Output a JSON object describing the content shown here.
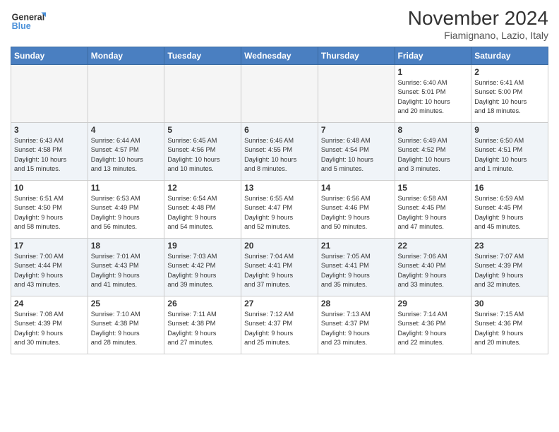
{
  "logo": {
    "line1": "General",
    "line2": "Blue"
  },
  "title": "November 2024",
  "location": "Fiamignano, Lazio, Italy",
  "days_of_week": [
    "Sunday",
    "Monday",
    "Tuesday",
    "Wednesday",
    "Thursday",
    "Friday",
    "Saturday"
  ],
  "weeks": [
    [
      {
        "num": "",
        "info": "",
        "empty": true
      },
      {
        "num": "",
        "info": "",
        "empty": true
      },
      {
        "num": "",
        "info": "",
        "empty": true
      },
      {
        "num": "",
        "info": "",
        "empty": true
      },
      {
        "num": "",
        "info": "",
        "empty": true
      },
      {
        "num": "1",
        "info": "Sunrise: 6:40 AM\nSunset: 5:01 PM\nDaylight: 10 hours\nand 20 minutes.",
        "empty": false
      },
      {
        "num": "2",
        "info": "Sunrise: 6:41 AM\nSunset: 5:00 PM\nDaylight: 10 hours\nand 18 minutes.",
        "empty": false
      }
    ],
    [
      {
        "num": "3",
        "info": "Sunrise: 6:43 AM\nSunset: 4:58 PM\nDaylight: 10 hours\nand 15 minutes.",
        "empty": false
      },
      {
        "num": "4",
        "info": "Sunrise: 6:44 AM\nSunset: 4:57 PM\nDaylight: 10 hours\nand 13 minutes.",
        "empty": false
      },
      {
        "num": "5",
        "info": "Sunrise: 6:45 AM\nSunset: 4:56 PM\nDaylight: 10 hours\nand 10 minutes.",
        "empty": false
      },
      {
        "num": "6",
        "info": "Sunrise: 6:46 AM\nSunset: 4:55 PM\nDaylight: 10 hours\nand 8 minutes.",
        "empty": false
      },
      {
        "num": "7",
        "info": "Sunrise: 6:48 AM\nSunset: 4:54 PM\nDaylight: 10 hours\nand 5 minutes.",
        "empty": false
      },
      {
        "num": "8",
        "info": "Sunrise: 6:49 AM\nSunset: 4:52 PM\nDaylight: 10 hours\nand 3 minutes.",
        "empty": false
      },
      {
        "num": "9",
        "info": "Sunrise: 6:50 AM\nSunset: 4:51 PM\nDaylight: 10 hours\nand 1 minute.",
        "empty": false
      }
    ],
    [
      {
        "num": "10",
        "info": "Sunrise: 6:51 AM\nSunset: 4:50 PM\nDaylight: 9 hours\nand 58 minutes.",
        "empty": false
      },
      {
        "num": "11",
        "info": "Sunrise: 6:53 AM\nSunset: 4:49 PM\nDaylight: 9 hours\nand 56 minutes.",
        "empty": false
      },
      {
        "num": "12",
        "info": "Sunrise: 6:54 AM\nSunset: 4:48 PM\nDaylight: 9 hours\nand 54 minutes.",
        "empty": false
      },
      {
        "num": "13",
        "info": "Sunrise: 6:55 AM\nSunset: 4:47 PM\nDaylight: 9 hours\nand 52 minutes.",
        "empty": false
      },
      {
        "num": "14",
        "info": "Sunrise: 6:56 AM\nSunset: 4:46 PM\nDaylight: 9 hours\nand 50 minutes.",
        "empty": false
      },
      {
        "num": "15",
        "info": "Sunrise: 6:58 AM\nSunset: 4:45 PM\nDaylight: 9 hours\nand 47 minutes.",
        "empty": false
      },
      {
        "num": "16",
        "info": "Sunrise: 6:59 AM\nSunset: 4:45 PM\nDaylight: 9 hours\nand 45 minutes.",
        "empty": false
      }
    ],
    [
      {
        "num": "17",
        "info": "Sunrise: 7:00 AM\nSunset: 4:44 PM\nDaylight: 9 hours\nand 43 minutes.",
        "empty": false
      },
      {
        "num": "18",
        "info": "Sunrise: 7:01 AM\nSunset: 4:43 PM\nDaylight: 9 hours\nand 41 minutes.",
        "empty": false
      },
      {
        "num": "19",
        "info": "Sunrise: 7:03 AM\nSunset: 4:42 PM\nDaylight: 9 hours\nand 39 minutes.",
        "empty": false
      },
      {
        "num": "20",
        "info": "Sunrise: 7:04 AM\nSunset: 4:41 PM\nDaylight: 9 hours\nand 37 minutes.",
        "empty": false
      },
      {
        "num": "21",
        "info": "Sunrise: 7:05 AM\nSunset: 4:41 PM\nDaylight: 9 hours\nand 35 minutes.",
        "empty": false
      },
      {
        "num": "22",
        "info": "Sunrise: 7:06 AM\nSunset: 4:40 PM\nDaylight: 9 hours\nand 33 minutes.",
        "empty": false
      },
      {
        "num": "23",
        "info": "Sunrise: 7:07 AM\nSunset: 4:39 PM\nDaylight: 9 hours\nand 32 minutes.",
        "empty": false
      }
    ],
    [
      {
        "num": "24",
        "info": "Sunrise: 7:08 AM\nSunset: 4:39 PM\nDaylight: 9 hours\nand 30 minutes.",
        "empty": false
      },
      {
        "num": "25",
        "info": "Sunrise: 7:10 AM\nSunset: 4:38 PM\nDaylight: 9 hours\nand 28 minutes.",
        "empty": false
      },
      {
        "num": "26",
        "info": "Sunrise: 7:11 AM\nSunset: 4:38 PM\nDaylight: 9 hours\nand 27 minutes.",
        "empty": false
      },
      {
        "num": "27",
        "info": "Sunrise: 7:12 AM\nSunset: 4:37 PM\nDaylight: 9 hours\nand 25 minutes.",
        "empty": false
      },
      {
        "num": "28",
        "info": "Sunrise: 7:13 AM\nSunset: 4:37 PM\nDaylight: 9 hours\nand 23 minutes.",
        "empty": false
      },
      {
        "num": "29",
        "info": "Sunrise: 7:14 AM\nSunset: 4:36 PM\nDaylight: 9 hours\nand 22 minutes.",
        "empty": false
      },
      {
        "num": "30",
        "info": "Sunrise: 7:15 AM\nSunset: 4:36 PM\nDaylight: 9 hours\nand 20 minutes.",
        "empty": false
      }
    ]
  ]
}
